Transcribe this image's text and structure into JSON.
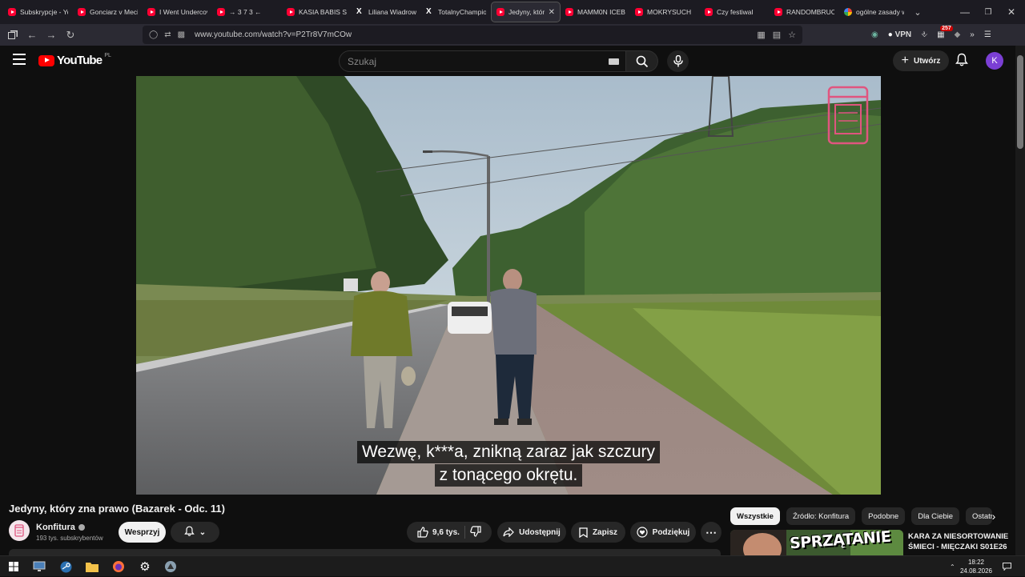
{
  "browser": {
    "tabs": [
      {
        "label": "Subskrypcje - Yo",
        "icon": "youtube-icon"
      },
      {
        "label": "Gonciarz v Mecie",
        "icon": "youtube-icon"
      },
      {
        "label": "I Went Undercov",
        "icon": "youtube-icon"
      },
      {
        "label": "→ 3 7 3 ←",
        "icon": "youtube-icon"
      },
      {
        "label": "KASIA BABIS SZC",
        "icon": "youtube-icon"
      },
      {
        "label": "Liliana Wiadrowsk",
        "icon": "x-icon"
      },
      {
        "label": "TotalnyChampio",
        "icon": "x-icon"
      },
      {
        "label": "Jedyny, który",
        "icon": "youtube-icon",
        "active": true
      },
      {
        "label": "MAMM0N ICEB",
        "icon": "youtube-icon"
      },
      {
        "label": "MOKRYSUCH",
        "icon": "youtube-icon"
      },
      {
        "label": "Czy festiwal",
        "icon": "youtube-icon"
      },
      {
        "label": "RANDOMBRUCE",
        "icon": "youtube-icon"
      },
      {
        "label": "ogólne zasady w",
        "icon": "google-icon"
      }
    ],
    "url": "www.youtube.com/watch?v=P2Tr8V7mCOw",
    "vpn_label": "VPN",
    "extension_badge": "257"
  },
  "youtube": {
    "logo_text": "YouTube",
    "country_code": "PL",
    "search_placeholder": "Szukaj",
    "create_label": "Utwórz",
    "avatar_letter": "K",
    "captions": [
      "Wezwę, k***a, znikną zaraz jak szczury",
      "z tonącego okrętu."
    ],
    "video_title": "Jedyny, który zna prawo (Bazarek - Odc. 11)",
    "channel_name": "Konfitura",
    "subscribers": "193 tys. subskrybentów",
    "support_label": "Wesprzyj",
    "likes": "9,6 tys.",
    "share_label": "Udostępnij",
    "save_label": "Zapisz",
    "thanks_label": "Podziękuj",
    "chips": [
      "Wszystkie",
      "Źródło: Konfitura",
      "Podobne",
      "Dla Ciebie",
      "Ostatnio"
    ],
    "recommendation": {
      "thumbnail_text": "SPRZĄTANIE",
      "title": "KARA ZA NIESORTOWANIE ŚMIECI - MIĘCZAKI S01E26"
    }
  },
  "taskbar": {
    "time": "18:22",
    "date": "24.08.2026"
  },
  "colors": {
    "youtube_red": "#ff0000",
    "avatar_purple": "#7b3fd4",
    "channel_logo_pink": "#e0557f"
  }
}
